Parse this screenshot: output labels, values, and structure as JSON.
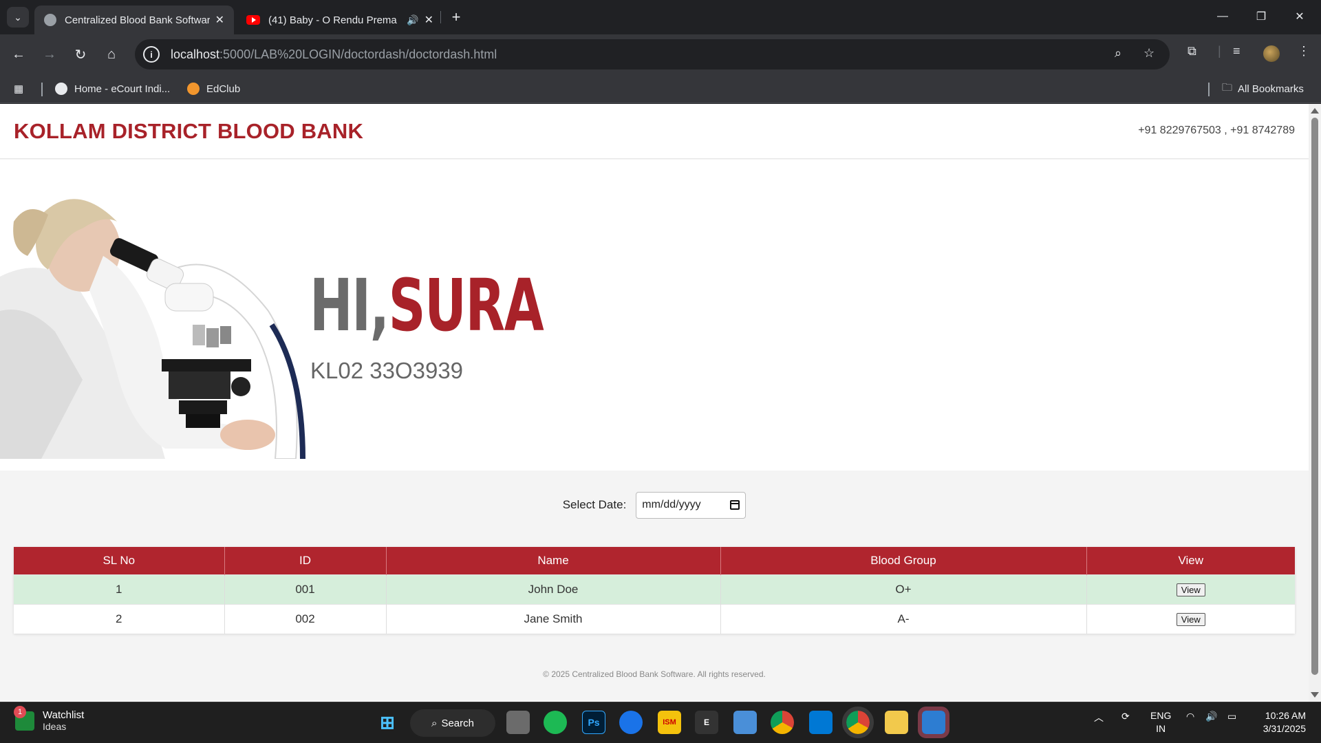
{
  "browser": {
    "tabs": [
      {
        "title": "Centralized Blood Bank Softwar",
        "active": true
      },
      {
        "title": "(41) Baby - O Rendu Prema",
        "active": false
      }
    ],
    "url_host": "localhost",
    "url_path": ":5000/LAB%20LOGIN/doctordash/doctordash.html",
    "bookmarks": [
      {
        "label": "Home - eCourt Indi..."
      },
      {
        "label": "EdClub"
      }
    ],
    "all_bookmarks_label": "All Bookmarks"
  },
  "site": {
    "title": "KOLLAM DISTRICT BLOOD BANK",
    "phone": "+91 8229767503 , +91 8742789"
  },
  "hero": {
    "greeting_prefix": "HI,",
    "user_name": "SURA",
    "user_id": "KL02 33O3939"
  },
  "filter": {
    "label": "Select Date:",
    "date_placeholder": "mm/dd/yyyy"
  },
  "table": {
    "columns": [
      "SL No",
      "ID",
      "Name",
      "Blood Group",
      "View"
    ],
    "rows": [
      {
        "sl": "1",
        "id": "001",
        "name": "John Doe",
        "blood_group": "O+",
        "action": "View"
      },
      {
        "sl": "2",
        "id": "002",
        "name": "Jane Smith",
        "blood_group": "A-",
        "action": "View"
      }
    ]
  },
  "footer": {
    "text": "© 2025 Centralized Blood Bank Software. All rights reserved."
  },
  "taskbar": {
    "widget_title": "Watchlist",
    "widget_subtitle": "Ideas",
    "widget_badge": "1",
    "search_label": "Search",
    "lang_top": "ENG",
    "lang_bottom": "IN",
    "time": "10:26 AM",
    "date": "3/31/2025"
  },
  "colors": {
    "brand": "#a82229",
    "table_header": "#b0252e",
    "highlight_row": "#d6eedb"
  }
}
